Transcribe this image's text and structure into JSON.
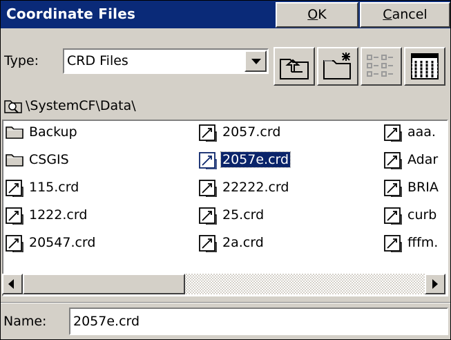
{
  "window": {
    "title": "Coordinate Files",
    "ok_label": "OK",
    "ok_accel": "O",
    "ok_rest": "K",
    "cancel_label": "Cancel",
    "cancel_accel": "C",
    "cancel_rest": "ancel"
  },
  "type_row": {
    "label": "Type:",
    "selected": "CRD Files",
    "tools": [
      "up-folder-icon",
      "new-folder-icon",
      "list-view-icon",
      "details-view-icon"
    ]
  },
  "path": {
    "icon": "folder-search-icon",
    "text": "\\SystemCF\\Data\\"
  },
  "files": {
    "columns": [
      [
        {
          "name": "Backup",
          "icon": "folder-icon"
        },
        {
          "name": "CSGIS",
          "icon": "folder-icon"
        },
        {
          "name": "115.crd",
          "icon": "crd-file-icon"
        },
        {
          "name": "1222.crd",
          "icon": "crd-file-icon"
        },
        {
          "name": "20547.crd",
          "icon": "crd-file-icon"
        }
      ],
      [
        {
          "name": "2057.crd",
          "icon": "crd-file-icon"
        },
        {
          "name": "2057e.crd",
          "icon": "crd-file-icon",
          "selected": true
        },
        {
          "name": "22222.crd",
          "icon": "crd-file-icon"
        },
        {
          "name": "25.crd",
          "icon": "crd-file-icon"
        },
        {
          "name": "2a.crd",
          "icon": "crd-file-icon"
        }
      ],
      [
        {
          "name": "aaa.",
          "icon": "crd-file-icon"
        },
        {
          "name": "Adar",
          "icon": "crd-file-icon"
        },
        {
          "name": "BRIA",
          "icon": "crd-file-icon"
        },
        {
          "name": "curb",
          "icon": "crd-file-icon"
        },
        {
          "name": "fffm.",
          "icon": "crd-file-icon"
        }
      ]
    ]
  },
  "name_row": {
    "label": "Name:",
    "value": "2057e.crd"
  },
  "colors": {
    "titlebar": "#0a2a78",
    "selection": "#0a246a",
    "face": "#d4d0c8"
  }
}
